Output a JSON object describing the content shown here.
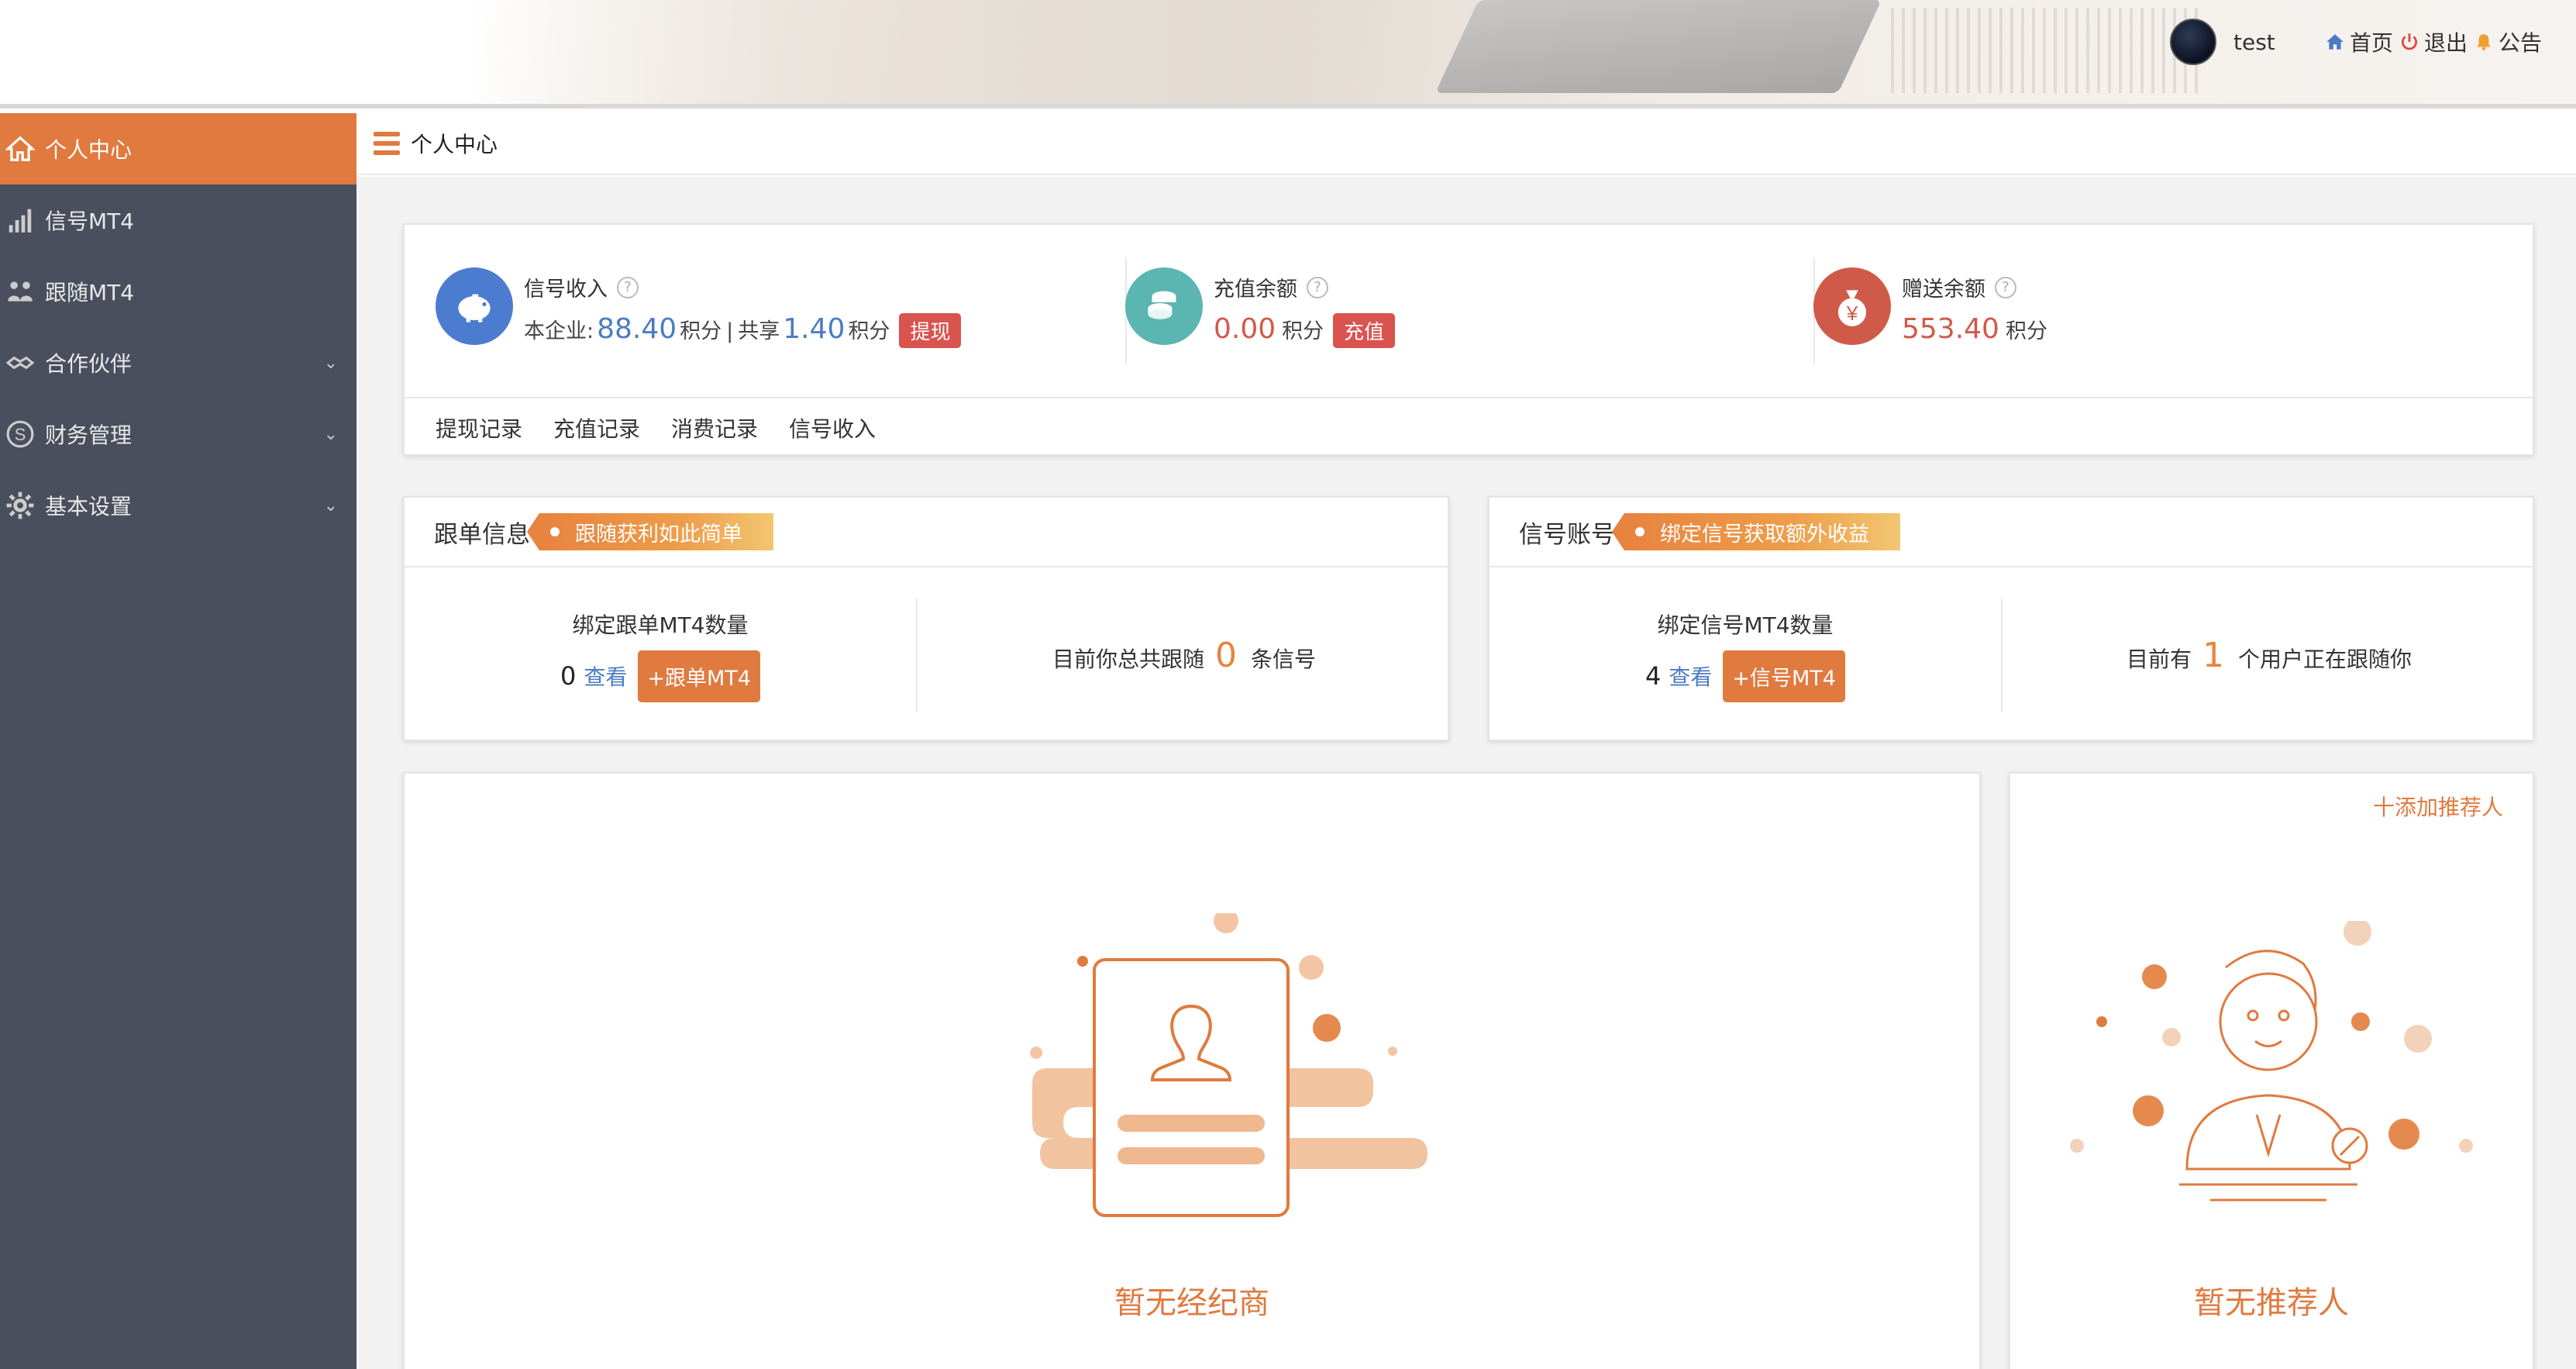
{
  "header": {
    "username": "test",
    "links": [
      {
        "label": "首页",
        "icon": "home-icon"
      },
      {
        "label": "退出",
        "icon": "power-icon"
      },
      {
        "label": "公告",
        "icon": "bell-icon"
      }
    ]
  },
  "sidebar": {
    "items": [
      {
        "label": "个人中心",
        "icon": "home-icon",
        "active": true
      },
      {
        "label": "信号MT4",
        "icon": "signal-bars-icon"
      },
      {
        "label": "跟随MT4",
        "icon": "users-icon"
      },
      {
        "label": "合作伙伴",
        "icon": "handshake-icon",
        "expandable": true
      },
      {
        "label": "财务管理",
        "icon": "dollar-circle-icon",
        "expandable": true
      },
      {
        "label": "基本设置",
        "icon": "gear-icon",
        "expandable": true
      }
    ]
  },
  "breadcrumb": {
    "title": "个人中心"
  },
  "balance": {
    "signal_income": {
      "title": "信号收入",
      "enterprise_label": "本企业:",
      "enterprise_value": "88.40",
      "unit": "积分",
      "sep": "|",
      "shared_label": "共享",
      "shared_value": "1.40",
      "button": "提现"
    },
    "recharge": {
      "title": "充值余额",
      "value": "0.00",
      "unit": "积分",
      "button": "充值"
    },
    "gift": {
      "title": "赠送余额",
      "value": "553.40",
      "unit": "积分"
    },
    "tabs": [
      "提现记录",
      "充值记录",
      "消费记录",
      "信号收入"
    ]
  },
  "follow_info": {
    "title": "跟单信息",
    "tag": "跟随获利如此简单",
    "bind_label": "绑定跟单MT4数量",
    "count": "0",
    "view": "查看",
    "button": "+跟单MT4",
    "total_prefix": "目前你总共跟随",
    "total_value": "0",
    "total_suffix": "条信号"
  },
  "signal_account": {
    "title": "信号账号",
    "tag": "绑定信号获取额外收益",
    "bind_label": "绑定信号MT4数量",
    "count": "4",
    "view": "查看",
    "button": "+信号MT4",
    "followers_prefix": "目前有",
    "followers_value": "1",
    "followers_suffix": "个用户正在跟随你"
  },
  "broker": {
    "empty_text": "暂无经纪商"
  },
  "referrer": {
    "add_label": "十添加推荐人",
    "empty_text": "暂无推荐人"
  },
  "colors": {
    "accent": "#e07a3f",
    "sidebar_bg": "#4a4f5d",
    "blue_value": "#4b7cc3",
    "red_value": "#d05a4a",
    "red_button": "#d9534f"
  }
}
